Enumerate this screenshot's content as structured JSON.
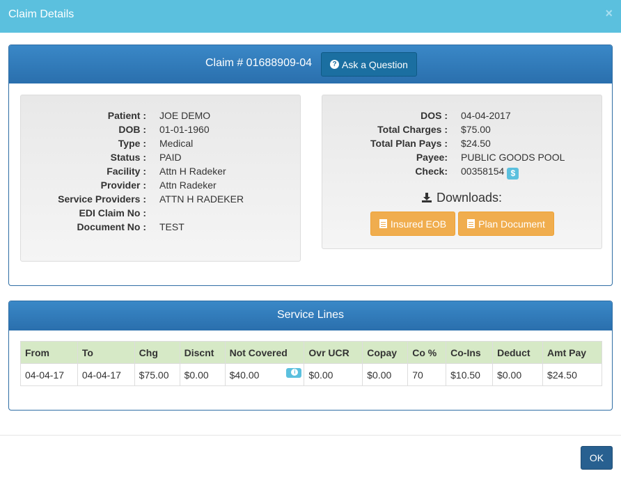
{
  "modal": {
    "title": "Claim Details",
    "close_symbol": "×",
    "ok_label": "OK"
  },
  "claim": {
    "number_text": "Claim # 01688909-04",
    "ask_label": "Ask a Question",
    "ask_icon": "question-circle-icon"
  },
  "patient_info": [
    {
      "label": "Patient :",
      "value": "JOE DEMO"
    },
    {
      "label": "DOB :",
      "value": "01-01-1960"
    },
    {
      "label": "Type :",
      "value": "Medical"
    },
    {
      "label": "Status :",
      "value": "PAID"
    },
    {
      "label": "Facility :",
      "value": "Attn H Radeker"
    },
    {
      "label": "Provider :",
      "value": "Attn Radeker"
    },
    {
      "label": "Service Providers :",
      "value": "ATTN H RADEKER"
    },
    {
      "label": "EDI Claim No :",
      "value": ""
    },
    {
      "label": "Document No :",
      "value": "TEST"
    }
  ],
  "payment_info": [
    {
      "label": "DOS :",
      "value": "04-04-2017"
    },
    {
      "label": "Total Charges :",
      "value": "$75.00"
    },
    {
      "label": "Total Plan Pays :",
      "value": "$24.50"
    },
    {
      "label": "Payee:",
      "value": "PUBLIC GOODS POOL"
    },
    {
      "label": "Check:",
      "value": "00358154"
    }
  ],
  "check_badge": "$",
  "downloads": {
    "title": "Downloads:",
    "icon": "download-icon",
    "insured_eob": "Insured EOB",
    "plan_document": "Plan Document",
    "doc_icon": "file-text-icon"
  },
  "service_lines": {
    "title": "Service Lines",
    "columns": [
      "From",
      "To",
      "Chg",
      "Discnt",
      "Not Covered",
      "Ovr UCR",
      "Copay",
      "Co %",
      "Co-Ins",
      "Deduct",
      "Amt Pay"
    ],
    "rows": [
      [
        "04-04-17",
        "04-04-17",
        "$75.00",
        "$0.00",
        "$40.00",
        "$0.00",
        "$0.00",
        "70",
        "$10.50",
        "$0.00",
        "$24.50"
      ]
    ],
    "info_icon": "info-circle-icon"
  },
  "colors": {
    "header_bg": "#5bc0de",
    "panel_heading": "#2a6fad",
    "ask_button": "#1b6fa1",
    "warning_button": "#f0ad4e",
    "table_header": "#d6e9c6",
    "ok_button": "#286090"
  }
}
